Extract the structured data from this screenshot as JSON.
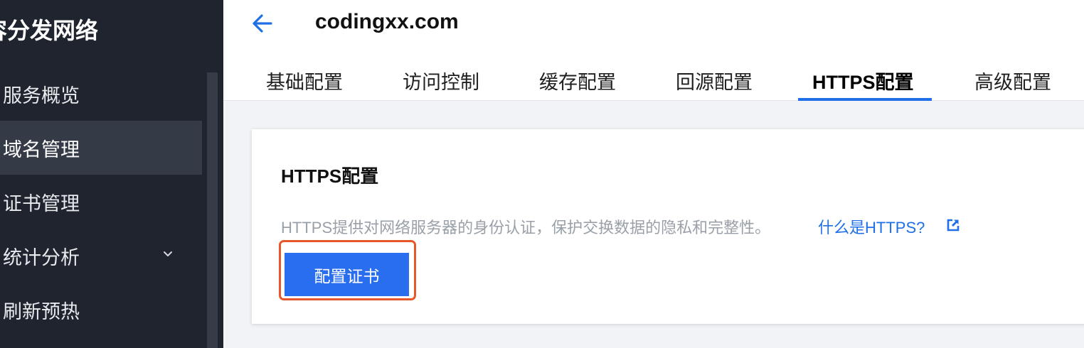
{
  "sidebar": {
    "title": "容分发网络",
    "items": [
      {
        "label": "服务概览",
        "active": false
      },
      {
        "label": "域名管理",
        "active": true
      },
      {
        "label": "证书管理",
        "active": false
      },
      {
        "label": "统计分析",
        "active": false,
        "icon": "chevron-down-icon"
      },
      {
        "label": "刷新预热",
        "active": false
      }
    ]
  },
  "header": {
    "back_icon": "arrow-left-icon",
    "domain": "codingxx.com"
  },
  "tabs": [
    {
      "label": "基础配置"
    },
    {
      "label": "访问控制"
    },
    {
      "label": "缓存配置"
    },
    {
      "label": "回源配置"
    },
    {
      "label": "HTTPS配置",
      "active": true
    },
    {
      "label": "高级配置"
    }
  ],
  "card": {
    "title": "HTTPS配置",
    "description": "HTTPS提供对网络服务器的身份认证，保护交换数据的隐私和完整性。",
    "help_link": "什么是HTTPS?",
    "help_icon": "external-link-icon",
    "button_label": "配置证书"
  },
  "colors": {
    "accent": "#1f6fe8",
    "button": "#2a6ef0",
    "highlight": "#e8572a",
    "sidebar_bg": "#20242e"
  }
}
